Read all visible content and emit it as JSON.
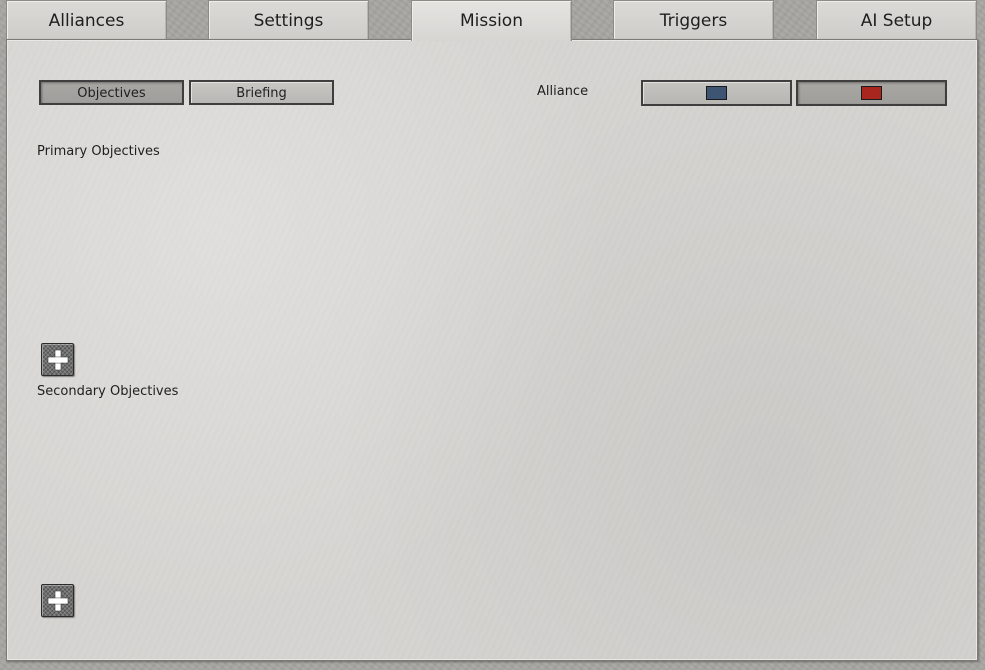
{
  "tabs": [
    {
      "label": "Alliances",
      "active": false
    },
    {
      "label": "Settings",
      "active": false
    },
    {
      "label": "Mission",
      "active": true
    },
    {
      "label": "Triggers",
      "active": false
    },
    {
      "label": "AI Setup",
      "active": false
    }
  ],
  "mission": {
    "subtabs": [
      {
        "label": "Objectives",
        "selected": true
      },
      {
        "label": "Briefing",
        "selected": false
      }
    ],
    "alliance_label": "Alliance",
    "alliances": [
      {
        "color": "#3d5573",
        "selected": false
      },
      {
        "color": "#a8261d",
        "selected": true
      }
    ],
    "primary_title": "Primary Objectives",
    "secondary_title": "Secondary Objectives"
  },
  "icons": {
    "add": "plus-icon",
    "team_marker": "color-swatch"
  }
}
